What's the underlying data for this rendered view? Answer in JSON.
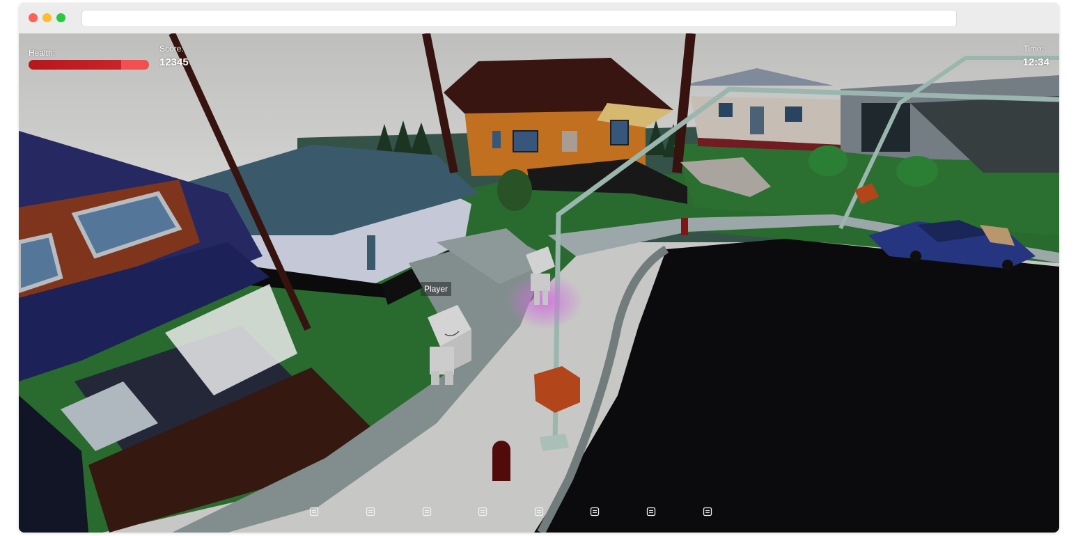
{
  "window": {
    "controls": [
      "close",
      "minimize",
      "zoom"
    ],
    "address": ""
  },
  "hud": {
    "health_label": "Health:",
    "health_level": 0.77,
    "score_label": "Score:",
    "score_value": "12345",
    "time_label": "Time:",
    "time_value": "12:34"
  },
  "player": {
    "name_tag": "Player"
  },
  "hotbar": {
    "slot_icon": "inventory-slot-icon",
    "slot_count": 8
  },
  "colors": {
    "health_fill": "#b5171c",
    "health_track": "#f05050",
    "grass": "#2f7a35",
    "road": "#0e0e10",
    "sidewalk": "#a9b6b8",
    "glow": "#d060e0"
  }
}
